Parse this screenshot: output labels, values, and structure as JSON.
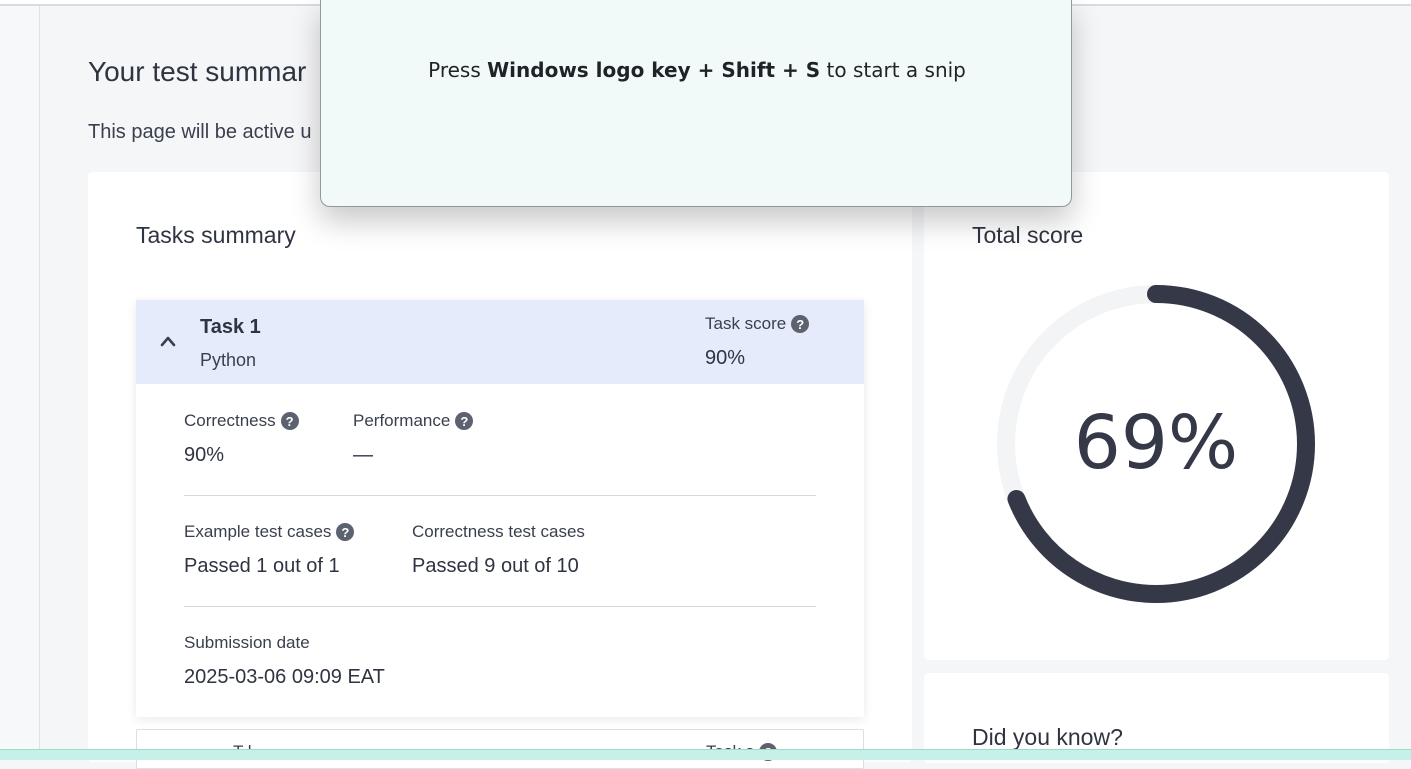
{
  "page": {
    "title": "Your test summar",
    "subtitle": "This page will be active u"
  },
  "tasks_summary": {
    "heading": "Tasks summary",
    "task1": {
      "title": "Task 1",
      "language": "Python",
      "task_score_label": "Task score",
      "task_score_value": "90%",
      "correctness_label": "Correctness",
      "correctness_value": "90%",
      "performance_label": "Performance",
      "performance_value": "—",
      "example_label": "Example test cases",
      "example_value": "Passed 1 out of 1",
      "correctness_tests_label": "Correctness test cases",
      "correctness_tests_value": "Passed 9 out of 10",
      "submission_label": "Submission date",
      "submission_value": "2025-03-06 09:09 EAT"
    },
    "task2_partial": {
      "title_fragment": "T    l",
      "score_label_fragment": "Task s"
    }
  },
  "total_score": {
    "heading": "Total score",
    "value_text": "69%",
    "fraction": 0.69,
    "ring_color": "#343847",
    "track_color": "#f3f4f6"
  },
  "did_you_know": {
    "heading": "Did you know?"
  },
  "snip_overlay": {
    "prefix": "Press ",
    "keys": "Windows logo key + Shift + S",
    "suffix": " to start a snip"
  },
  "icons": {
    "help": "question-circle-icon",
    "collapse": "chevron-up-icon"
  }
}
